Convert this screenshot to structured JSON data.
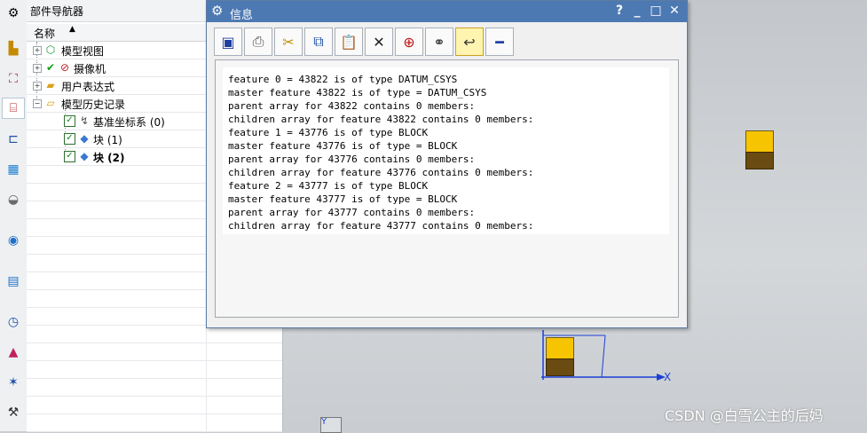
{
  "left_toolbar": {
    "icons": [
      "gear-icon",
      "part-icon",
      "assembly-icon",
      "navigator-icon",
      "constraint-icon",
      "palette-icon",
      "history-icon",
      "network-icon",
      "document-icon",
      "clock-icon",
      "material-icon",
      "analysis-icon",
      "process-icon"
    ]
  },
  "navigator": {
    "title": "部件导航器",
    "column_name": "名称",
    "sort_indicator": "▲",
    "items": [
      {
        "label": "模型视图",
        "icon": "model-view-icon"
      },
      {
        "label": "摄像机",
        "icon": "camera-icon"
      },
      {
        "label": "用户表达式",
        "icon": "folder-icon"
      },
      {
        "label": "模型历史记录",
        "icon": "folder-open-icon"
      },
      {
        "label": "基准坐标系 (0)",
        "icon": "datum-csys-icon"
      },
      {
        "label": "块 (1)",
        "icon": "block-icon"
      },
      {
        "label": "块 (2)",
        "icon": "block-icon"
      }
    ]
  },
  "dialog": {
    "title": "信息",
    "help": "?",
    "minimize": "_",
    "maximize": "□",
    "close": "✕",
    "toolbar": [
      "save-icon",
      "print-icon",
      "cut-icon",
      "copy-icon",
      "paste-icon",
      "delete-icon",
      "find-icon",
      "binoculars-icon",
      "wrap-icon",
      "minus-icon"
    ],
    "lines": [
      "feature 0 = 43822 is of type DATUM_CSYS",
      "master feature 43822 is of type = DATUM_CSYS",
      "parent array for 43822 contains 0 members:",
      "children array for feature 43822 contains 0 members:",
      "feature 1 = 43776 is of type BLOCK",
      "master feature 43776 is of type = BLOCK",
      "parent array for 43776 contains 0 members:",
      "children array for feature 43776 contains 0 members:",
      "feature 2 = 43777 is of type BLOCK",
      "master feature 43777 is of type = BLOCK",
      "parent array for 43777 contains 0 members:",
      "children array for feature 43777 contains 0 members:"
    ]
  },
  "viewport": {
    "axis_x": "X",
    "axis_y": "Y",
    "watermark": "CSDN @白雪公主的后妈"
  },
  "colors": {
    "title_bar": "#4d79b3",
    "cube_top": "#f6c400",
    "cube_side": "#6a4b11",
    "axis": "#1c3fd6"
  }
}
